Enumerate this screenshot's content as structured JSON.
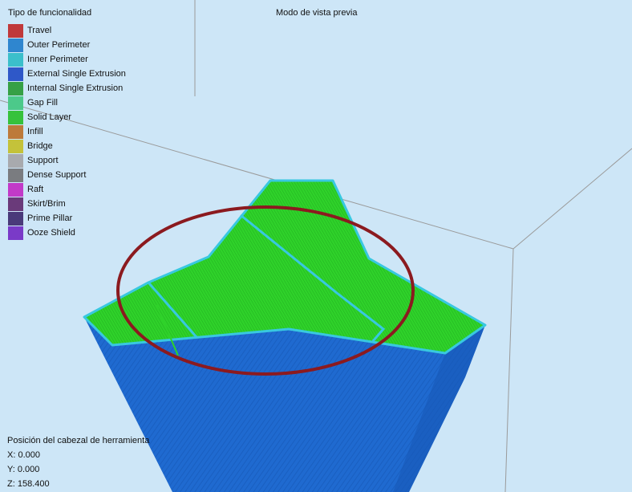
{
  "legend": {
    "title": "Tipo de funcionalidad",
    "items": [
      {
        "label": "Travel",
        "color": "#c0393b"
      },
      {
        "label": "Outer Perimeter",
        "color": "#2f86cf"
      },
      {
        "label": "Inner Perimeter",
        "color": "#3bbfcb"
      },
      {
        "label": "External Single Extrusion",
        "color": "#2f58c8"
      },
      {
        "label": "Internal Single Extrusion",
        "color": "#36a046"
      },
      {
        "label": "Gap Fill",
        "color": "#4cc98a"
      },
      {
        "label": "Solid Layer",
        "color": "#36c23c"
      },
      {
        "label": "Infill",
        "color": "#bd7a3a"
      },
      {
        "label": "Bridge",
        "color": "#c4c23a"
      },
      {
        "label": "Support",
        "color": "#a8aaae"
      },
      {
        "label": "Dense Support",
        "color": "#7a7c80"
      },
      {
        "label": "Raft",
        "color": "#c23ac8"
      },
      {
        "label": "Skirt/Brim",
        "color": "#6a3a7a"
      },
      {
        "label": "Prime Pillar",
        "color": "#4a3a7a"
      },
      {
        "label": "Ooze Shield",
        "color": "#7a3ac8"
      }
    ]
  },
  "view": {
    "mode_title": "Modo de vista previa",
    "object_color": "#1f6ad0",
    "top_color": "#2fd22a",
    "outline_color": "#38c8e0",
    "highlight_color": "#8b1a1f"
  },
  "position": {
    "title": "Posición del cabezal de herramienta",
    "x": "X: 0.000",
    "y": "Y: 0.000",
    "z": "Z: 158.400"
  }
}
